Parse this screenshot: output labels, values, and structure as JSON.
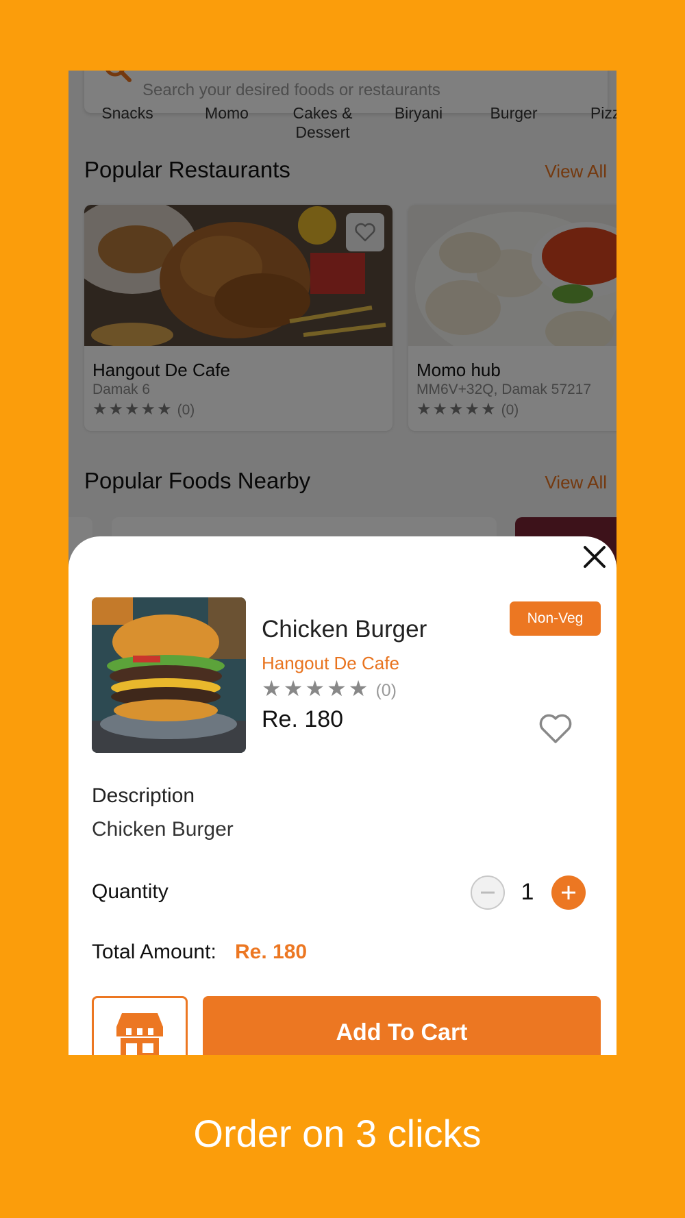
{
  "search": {
    "placeholder": "Search your desired foods or restaurants"
  },
  "categories": [
    "Snacks",
    "Momo",
    "Cakes &\nDessert",
    "Biryani",
    "Burger",
    "Pizza"
  ],
  "popular_restaurants": {
    "title": "Popular Restaurants",
    "view_all": "View All",
    "items": [
      {
        "name": "Hangout De Cafe",
        "address": "Damak 6",
        "stars": "★★★★★",
        "count": "(0)"
      },
      {
        "name": "Momo hub",
        "address": "MM6V+32Q, Damak 57217",
        "stars": "★★★★★",
        "count": "(0)"
      }
    ]
  },
  "popular_foods": {
    "title": "Popular Foods Nearby",
    "view_all": "View All"
  },
  "sheet": {
    "food_name": "Chicken Burger",
    "restaurant": "Hangout De Cafe",
    "stars": "★★★★★",
    "rating_count": "(0)",
    "price": "Re. 180",
    "badge": "Non-Veg",
    "description_label": "Description",
    "description": "Chicken Burger",
    "quantity_label": "Quantity",
    "quantity": "1",
    "total_label": "Total Amount:",
    "total_value": "Re. 180",
    "add_to_cart": "Add To Cart"
  },
  "caption": "Order on 3 clicks",
  "colors": {
    "background": "#FB9D0B",
    "accent": "#EC7722"
  }
}
